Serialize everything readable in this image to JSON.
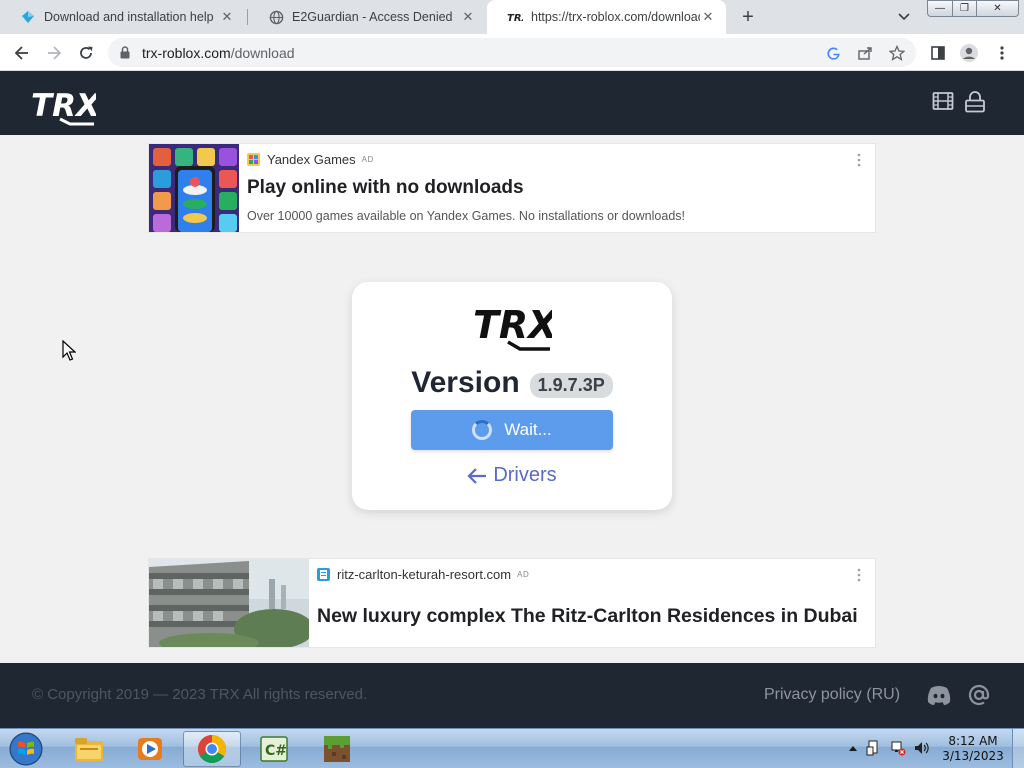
{
  "browser": {
    "tabs": [
      {
        "title": "Download and installation help",
        "favicon": "roblox-diamond-icon",
        "active": false
      },
      {
        "title": "E2Guardian - Access Denied",
        "favicon": "globe-icon",
        "active": false
      },
      {
        "title": "https://trx-roblox.com/download",
        "favicon": "trx-logo-icon",
        "active": true
      }
    ],
    "new_tab_label": "+",
    "url_host": "trx-roblox.com",
    "url_path": "/download",
    "window_controls": {
      "minimize": "—",
      "restore": "❐",
      "close": "✕"
    }
  },
  "site": {
    "logo_text": "TRX",
    "header_icons": [
      "film-icon",
      "lock-icon"
    ],
    "ad_top": {
      "source": "Yandex Games",
      "ad_tag": "AD",
      "title": "Play online with no downloads",
      "description": "Over 10000 games available on Yandex Games. No installations or downloads!"
    },
    "card": {
      "logo_text": "TRX",
      "version_label": "Version",
      "version_number": "1.9.7.3P",
      "button_label": "Wait...",
      "drivers_link": "Drivers"
    },
    "ad_bottom": {
      "source": "ritz-carlton-keturah-resort.com",
      "ad_tag": "AD",
      "title": "New luxury complex The Ritz-Carlton Residences in Dubai"
    },
    "footer": {
      "copyright": "© Copyright 2019 — 2023 TRX All rights reserved.",
      "privacy": "Privacy policy (RU)",
      "icons": [
        "discord-icon",
        "at-sign-icon"
      ]
    }
  },
  "taskbar": {
    "apps": [
      "explorer-icon",
      "media-player-icon",
      "chrome-icon",
      "csharp-icon",
      "minecraft-icon"
    ],
    "active_app": "chrome-icon",
    "time": "8:12 AM",
    "date": "3/13/2023"
  },
  "colors": {
    "site_dark": "#1f2733",
    "button_blue": "#5d9cec",
    "link_purple": "#5a6bc2"
  }
}
